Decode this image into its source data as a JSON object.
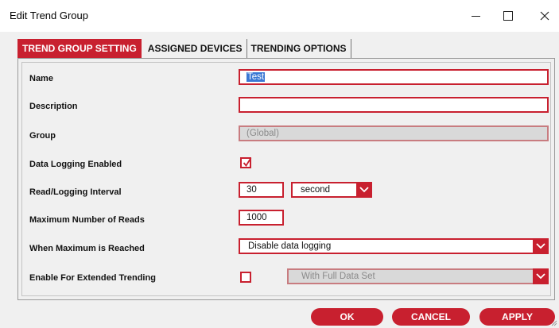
{
  "window": {
    "title": "Edit Trend Group",
    "minimize_glyph": "—",
    "maximize_glyph": "☐",
    "close_glyph": "✕"
  },
  "tabs": [
    {
      "label": "TREND GROUP SETTING",
      "active": true
    },
    {
      "label": "ASSIGNED DEVICES",
      "active": false
    },
    {
      "label": "TRENDING OPTIONS",
      "active": false
    }
  ],
  "form": {
    "name": {
      "label": "Name",
      "value": "Test"
    },
    "description": {
      "label": "Description",
      "value": ""
    },
    "group": {
      "label": "Group",
      "value": "(Global)"
    },
    "data_logging": {
      "label": "Data Logging Enabled",
      "checked": true
    },
    "interval": {
      "label": "Read/Logging Interval",
      "value": "30",
      "unit": "second"
    },
    "max_reads": {
      "label": "Maximum Number of Reads",
      "value": "1000"
    },
    "max_reached": {
      "label": "When Maximum is Reached",
      "value": "Disable data logging"
    },
    "extended": {
      "label": "Enable For Extended Trending",
      "checked": false,
      "option": "With Full Data Set"
    }
  },
  "buttons": {
    "ok": "OK",
    "cancel": "CANCEL",
    "apply": "APPLY"
  },
  "colors": {
    "accent": "#c8202f",
    "selection": "#3a78d4"
  }
}
